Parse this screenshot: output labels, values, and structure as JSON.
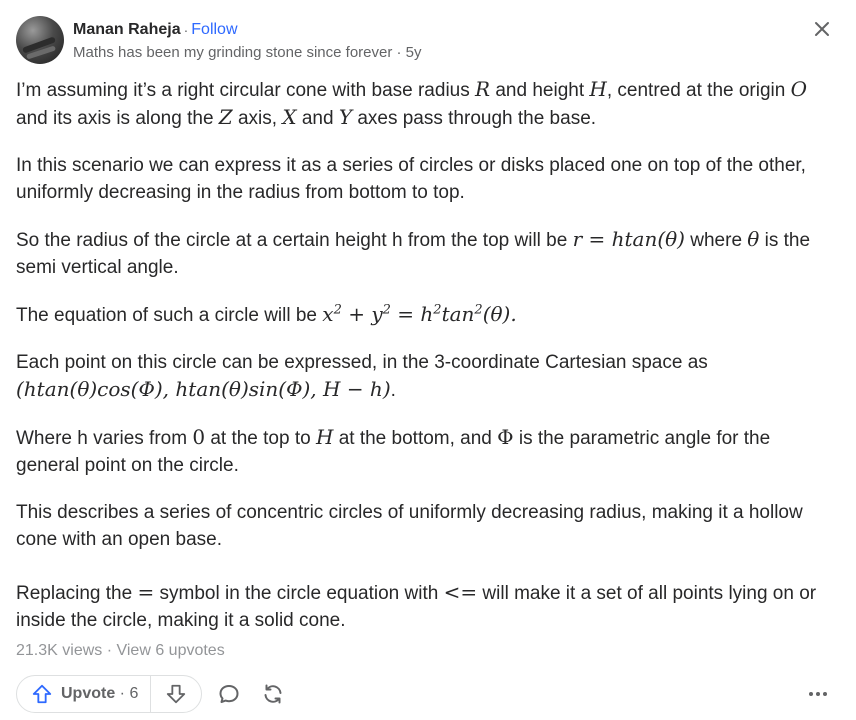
{
  "author": {
    "name": "Manan Raheja",
    "separator": "·",
    "follow_label": "Follow",
    "credential": "Maths has been my grinding stone since forever · 5y"
  },
  "answer": {
    "p1": {
      "a": "I’m assuming it’s a right circular cone with base radius ",
      "R": "R",
      "b": " and height ",
      "H": "H",
      "c": ", centred at the origin ",
      "O": "O",
      "d": " and its axis is along the ",
      "Z": "Z",
      "e": " axis, ",
      "X": "X",
      "f": " and ",
      "Y": "Y",
      "g": " axes pass through the base."
    },
    "p2": "In this scenario we can express it as a series of circles or disks placed one on top of the other, uniformly decreasing in the radius from bottom to top.",
    "p3": {
      "a": "So the radius of the circle at a certain height h from the top will be ",
      "eq": "r = htan(θ)",
      "b": " where ",
      "theta": "θ",
      "c": " is the semi vertical angle."
    },
    "p4": {
      "a": "The equation of such a circle will be ",
      "x": "x",
      "exp1": "2",
      "plus": " + ",
      "y": "y",
      "exp2": "2",
      "eqs": " = ",
      "h": "h",
      "exp3": "2",
      "tan": "tan",
      "exp4": "2",
      "tail": "(θ).",
      "period": ""
    },
    "p5": {
      "a": "Each point on this circle can be expressed, in the 3-coordinate Cartesian space as ",
      "eq": "(htan(θ)cos(Φ), htan(θ)sin(Φ), H − h)",
      "b": "."
    },
    "p6": {
      "a": "Where h varies from ",
      "zero": "0",
      "b": " at the top to ",
      "H": "H",
      "c": " at the bottom, and ",
      "Phi": "Φ",
      "d": " is the parametric angle for the general point on the circle."
    },
    "p7": "This describes a series of concentric circles of uniformly decreasing radius, making it a hollow cone with an open base.",
    "p8": {
      "a": "Replacing the ",
      "eqsym": "=",
      "b": " symbol in the circle equation with ",
      "lesym": "<=",
      "c": " will make it a set of all points lying on or inside the circle, making it a solid cone."
    }
  },
  "stats": {
    "views_text": "21.3K views · View 6 upvotes"
  },
  "actions": {
    "upvote_label": "Upvote",
    "upvote_sep": " · ",
    "upvote_count": "6"
  },
  "icons": {
    "close": "close-icon",
    "upvote": "upvote-arrow-icon",
    "downvote": "downvote-arrow-icon",
    "comment": "comment-bubble-icon",
    "share": "share-refresh-icon",
    "more": "more-dots-icon"
  },
  "colors": {
    "accent": "#2e69ff",
    "text": "#282829",
    "secondary": "#636466",
    "muted": "#939598"
  }
}
